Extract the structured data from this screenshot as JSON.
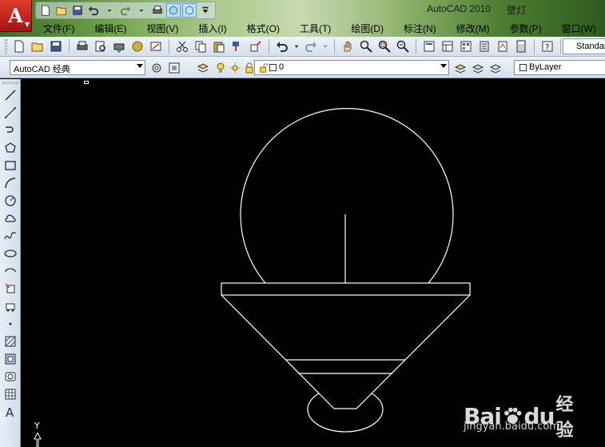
{
  "app": {
    "logo_letter": "A",
    "title": "AutoCAD 2010",
    "document": "壁灯"
  },
  "menu": {
    "items": [
      "文件(F)",
      "编辑(E)",
      "视图(V)",
      "插入(I)",
      "格式(O)",
      "工具(T)",
      "绘图(D)",
      "标注(N)",
      "修改(M)",
      "参数(P)",
      "窗口(W)"
    ]
  },
  "toolbar": {
    "text_style": "Standard"
  },
  "workspace": {
    "current": "AutoCAD 经典"
  },
  "layers": {
    "current": "0",
    "color": "ByLayer"
  },
  "ucs": {
    "axis_label": "Y"
  },
  "watermark": {
    "brand": "Bai",
    "brand_suffix": "du",
    "jingyan": "经验",
    "url": "jingyan.baidu.com"
  },
  "colors": {
    "canvas": "#000000",
    "linework": "#ffffff",
    "logo_red": "#d42a1f"
  }
}
